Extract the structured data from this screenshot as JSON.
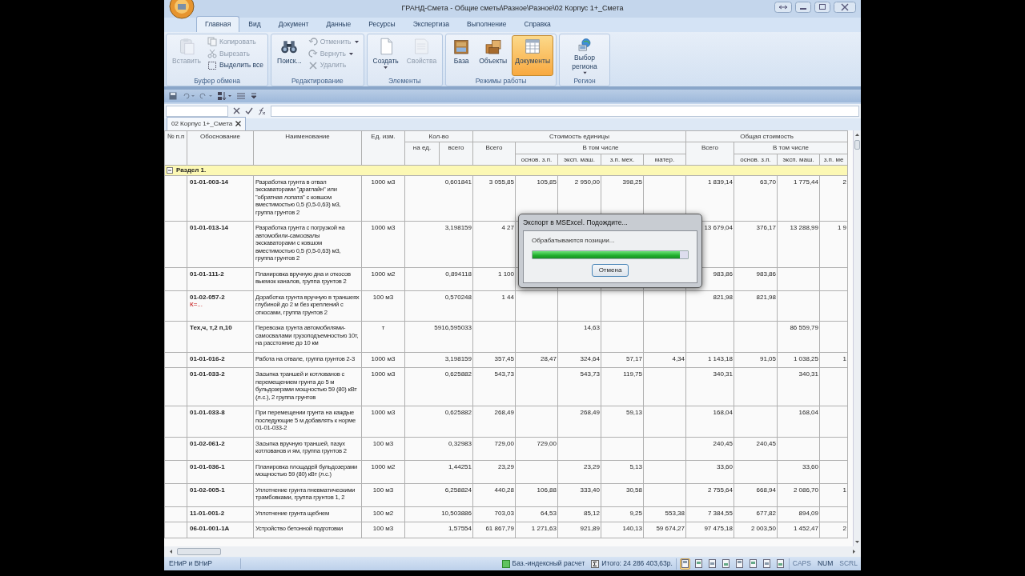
{
  "window": {
    "title": "ГРАНД-Смета - Общие сметы\\Разное\\Разное\\02 Корпус 1+_Смета"
  },
  "ribbon": {
    "tabs": [
      {
        "label": "Главная",
        "selected": true
      },
      {
        "label": "Вид",
        "selected": false
      },
      {
        "label": "Документ",
        "selected": false
      },
      {
        "label": "Данные",
        "selected": false
      },
      {
        "label": "Ресурсы",
        "selected": false
      },
      {
        "label": "Экспертиза",
        "selected": false
      },
      {
        "label": "Выполнение",
        "selected": false
      },
      {
        "label": "Справка",
        "selected": false
      }
    ],
    "groups": [
      {
        "label": "Буфер обмена",
        "items": [
          {
            "kind": "large",
            "label": "Вставить",
            "disabled": true
          },
          {
            "kind": "small",
            "label": "Копировать",
            "disabled": true
          },
          {
            "kind": "small",
            "label": "Вырезать",
            "disabled": true
          },
          {
            "kind": "small",
            "label": "Выделить все",
            "disabled": false
          }
        ]
      },
      {
        "label": "Редактирование",
        "items": [
          {
            "kind": "large",
            "label": "Поиск...",
            "disabled": false
          },
          {
            "kind": "small",
            "label": "Отменить",
            "disabled": true,
            "has_menu": true
          },
          {
            "kind": "small",
            "label": "Вернуть",
            "disabled": true,
            "has_menu": true
          },
          {
            "kind": "small",
            "label": "Удалить",
            "disabled": true
          }
        ]
      },
      {
        "label": "Элементы",
        "items": [
          {
            "kind": "large",
            "label": "Создать",
            "disabled": false,
            "has_menu": true
          },
          {
            "kind": "large",
            "label": "Свойства",
            "disabled": true
          }
        ]
      },
      {
        "label": "Режимы работы",
        "items": [
          {
            "kind": "large",
            "label": "База",
            "disabled": false,
            "selected": false
          },
          {
            "kind": "large",
            "label": "Объекты",
            "disabled": false,
            "selected": false
          },
          {
            "kind": "large",
            "label": "Документы",
            "disabled": false,
            "selected": true
          }
        ]
      },
      {
        "label": "Регион",
        "items": [
          {
            "kind": "large",
            "label": "Выбор региона",
            "disabled": false,
            "has_menu": true
          }
        ]
      }
    ]
  },
  "document_tabs": [
    {
      "label": "02 Корпус 1+_Смета",
      "selected": true
    }
  ],
  "table": {
    "columns": {
      "number": "№ п.п",
      "basis": "Обоснование",
      "name": "Наименование",
      "unit": "Ед. изм.",
      "quantity": {
        "label": "Кол-во",
        "sub": [
          "на ед.",
          "всего"
        ]
      },
      "unit_cost": {
        "label": "Стоимость единицы",
        "total": "Всего",
        "including": "В том числе",
        "sub": [
          "основ. з.п.",
          "эксп. маш.",
          "з.п. мех.",
          "матер."
        ]
      },
      "total_cost": {
        "label": "Общая стоимость",
        "total": "Всего",
        "including": "В том числе",
        "sub": [
          "основ. з.п.",
          "эксп. маш.",
          "з.п. ме"
        ]
      }
    },
    "section": {
      "label": "Раздел 1.",
      "expanded": true
    },
    "rows": [
      {
        "code": "01-01-003-14",
        "name": "Разработка грунта в отвал экскаваторами \"драглайн\" или \"обратная лопата\" с ковшом вместимостью 0,5 (0,5-0,63) м3, группа грунтов 2",
        "unit": "1000 м3",
        "values": {
          "qty_total": "0,601841",
          "unit_total": "3 055,85",
          "unit_base_wage": "105,85",
          "unit_machine": "2 950,00",
          "unit_mech_wage": "398,25",
          "total": "1 839,14",
          "total_base_wage": "63,70",
          "total_machine": "1 775,44",
          "total_mech_wage": "2"
        }
      },
      {
        "code": "01-01-013-14",
        "name": "Разработка грунта с погрузкой на автомобили-самосвалы экскаваторами с ковшом вместимостью 0,5 (0,5-0,63) м3, группа грунтов 2",
        "unit": "1000 м3",
        "values": {
          "qty_total": "3,198159",
          "unit_total": "4 27",
          "total": "13 679,04",
          "total_base_wage": "376,17",
          "total_machine": "13 288,99",
          "total_mech_wage": "1 9"
        }
      },
      {
        "code": "01-01-111-2",
        "name": "Планировка вручную дна и откосов выемок каналов, группа грунтов 2",
        "unit": "1000 м2",
        "values": {
          "qty_total": "0,894118",
          "unit_total": "1 100",
          "total": "983,86",
          "total_base_wage": "983,86"
        }
      },
      {
        "code": "01-02-057-2",
        "note": "К=...",
        "name": "Доработка грунта вручную в траншеях глубиной до 2 м без креплений с откосами, группа грунтов 2",
        "unit": "100 м3",
        "values": {
          "qty_total": "0,570248",
          "unit_total": "1 44",
          "total": "821,98",
          "total_base_wage": "821,98"
        }
      },
      {
        "code": "Тех,ч, т,2 п,10",
        "name": "Перевозка грунта автомобилями-самосвалами грузоподъемностью 10т, на расстояние до 10 км",
        "unit": "т",
        "values": {
          "qty_total": "5916,595033",
          "unit_machine": "14,63",
          "total_machine": "86 559,79"
        }
      },
      {
        "code": "01-01-016-2",
        "name": "Работа на отвале, группа грунтов 2-3",
        "unit": "1000 м3",
        "values": {
          "qty_total": "3,198159",
          "unit_total": "357,45",
          "unit_base_wage": "28,47",
          "unit_machine": "324,64",
          "unit_mech_wage": "57,17",
          "unit_material": "4,34",
          "total": "1 143,18",
          "total_base_wage": "91,05",
          "total_machine": "1 038,25",
          "total_mech_wage": "1"
        }
      },
      {
        "code": "01-01-033-2",
        "name": "Засыпка траншей и котлованов с перемещением грунта до 5 м бульдозерами мощностью 59 (80) кВт (л.с.), 2 группа грунтов",
        "unit": "1000 м3",
        "values": {
          "qty_total": "0,625882",
          "unit_total": "543,73",
          "unit_machine": "543,73",
          "unit_mech_wage": "119,75",
          "total": "340,31",
          "total_machine": "340,31"
        }
      },
      {
        "code": "01-01-033-8",
        "name": "При перемещении грунта на каждые последующие 5 м добавлять к норме 01-01-033-2",
        "unit": "1000 м3",
        "values": {
          "qty_total": "0,625882",
          "unit_total": "268,49",
          "unit_machine": "268,49",
          "unit_mech_wage": "59,13",
          "total": "168,04",
          "total_machine": "168,04"
        }
      },
      {
        "code": "01-02-061-2",
        "name": "Засыпка вручную траншей, пазух котлованов и ям, группа грунтов 2",
        "unit": "100 м3",
        "values": {
          "qty_total": "0,32983",
          "unit_total": "729,00",
          "unit_base_wage": "729,00",
          "total": "240,45",
          "total_base_wage": "240,45"
        }
      },
      {
        "code": "01-01-036-1",
        "name": "Планировка площадей бульдозерами мощностью 59 (80) кВт (л.с.)",
        "unit": "1000 м2",
        "values": {
          "qty_total": "1,44251",
          "unit_total": "23,29",
          "unit_machine": "23,29",
          "unit_mech_wage": "5,13",
          "total": "33,60",
          "total_machine": "33,60"
        }
      },
      {
        "code": "01-02-005-1",
        "name": "Уплотнение грунта пневматическими трамбовками, группа грунтов 1, 2",
        "unit": "100 м3",
        "values": {
          "qty_total": "6,258824",
          "unit_total": "440,28",
          "unit_base_wage": "106,88",
          "unit_machine": "333,40",
          "unit_mech_wage": "30,58",
          "total": "2 755,64",
          "total_base_wage": "668,94",
          "total_machine": "2 086,70",
          "total_mech_wage": "1"
        }
      },
      {
        "code": "11-01-001-2",
        "name": "Уплотнение грунта щебнем",
        "unit": "100 м2",
        "values": {
          "qty_total": "10,503886",
          "unit_total": "703,03",
          "unit_base_wage": "64,53",
          "unit_machine": "85,12",
          "unit_mech_wage": "9,25",
          "unit_material": "553,38",
          "total": "7 384,55",
          "total_base_wage": "677,82",
          "total_machine": "894,09"
        }
      },
      {
        "code": "06-01-001-1А",
        "name": "Устройство бетонной подготовки",
        "unit": "100 м3",
        "values": {
          "qty_total": "1,57554",
          "unit_total": "61 867,79",
          "unit_base_wage": "1 271,63",
          "unit_machine": "921,89",
          "unit_mech_wage": "140,13",
          "unit_material": "59 674,27",
          "total": "97 475,18",
          "total_base_wage": "2 003,50",
          "total_machine": "1 452,47",
          "total_mech_wage": "2"
        }
      }
    ]
  },
  "dialog": {
    "title": "Экспорт в MSExcel. Подождите...",
    "message": "Обрабатываются позиции...",
    "level": 0.95,
    "button": "Отмена"
  },
  "status_bar": {
    "left": "ЕНиР и ВНиР",
    "mode": "Баз.-индексный расчет",
    "total": "Итого: 24 286 403,63р.",
    "view_buttons": [
      {
        "selected": true
      },
      {
        "selected": false
      },
      {
        "selected": false
      },
      {
        "selected": false
      },
      {
        "selected": false
      },
      {
        "selected": false
      },
      {
        "selected": false
      },
      {
        "selected": false
      }
    ],
    "indicators": [
      {
        "label": "CAPS",
        "on": false
      },
      {
        "label": "NUM",
        "on": true
      },
      {
        "label": "SCRL",
        "on": false
      }
    ]
  }
}
